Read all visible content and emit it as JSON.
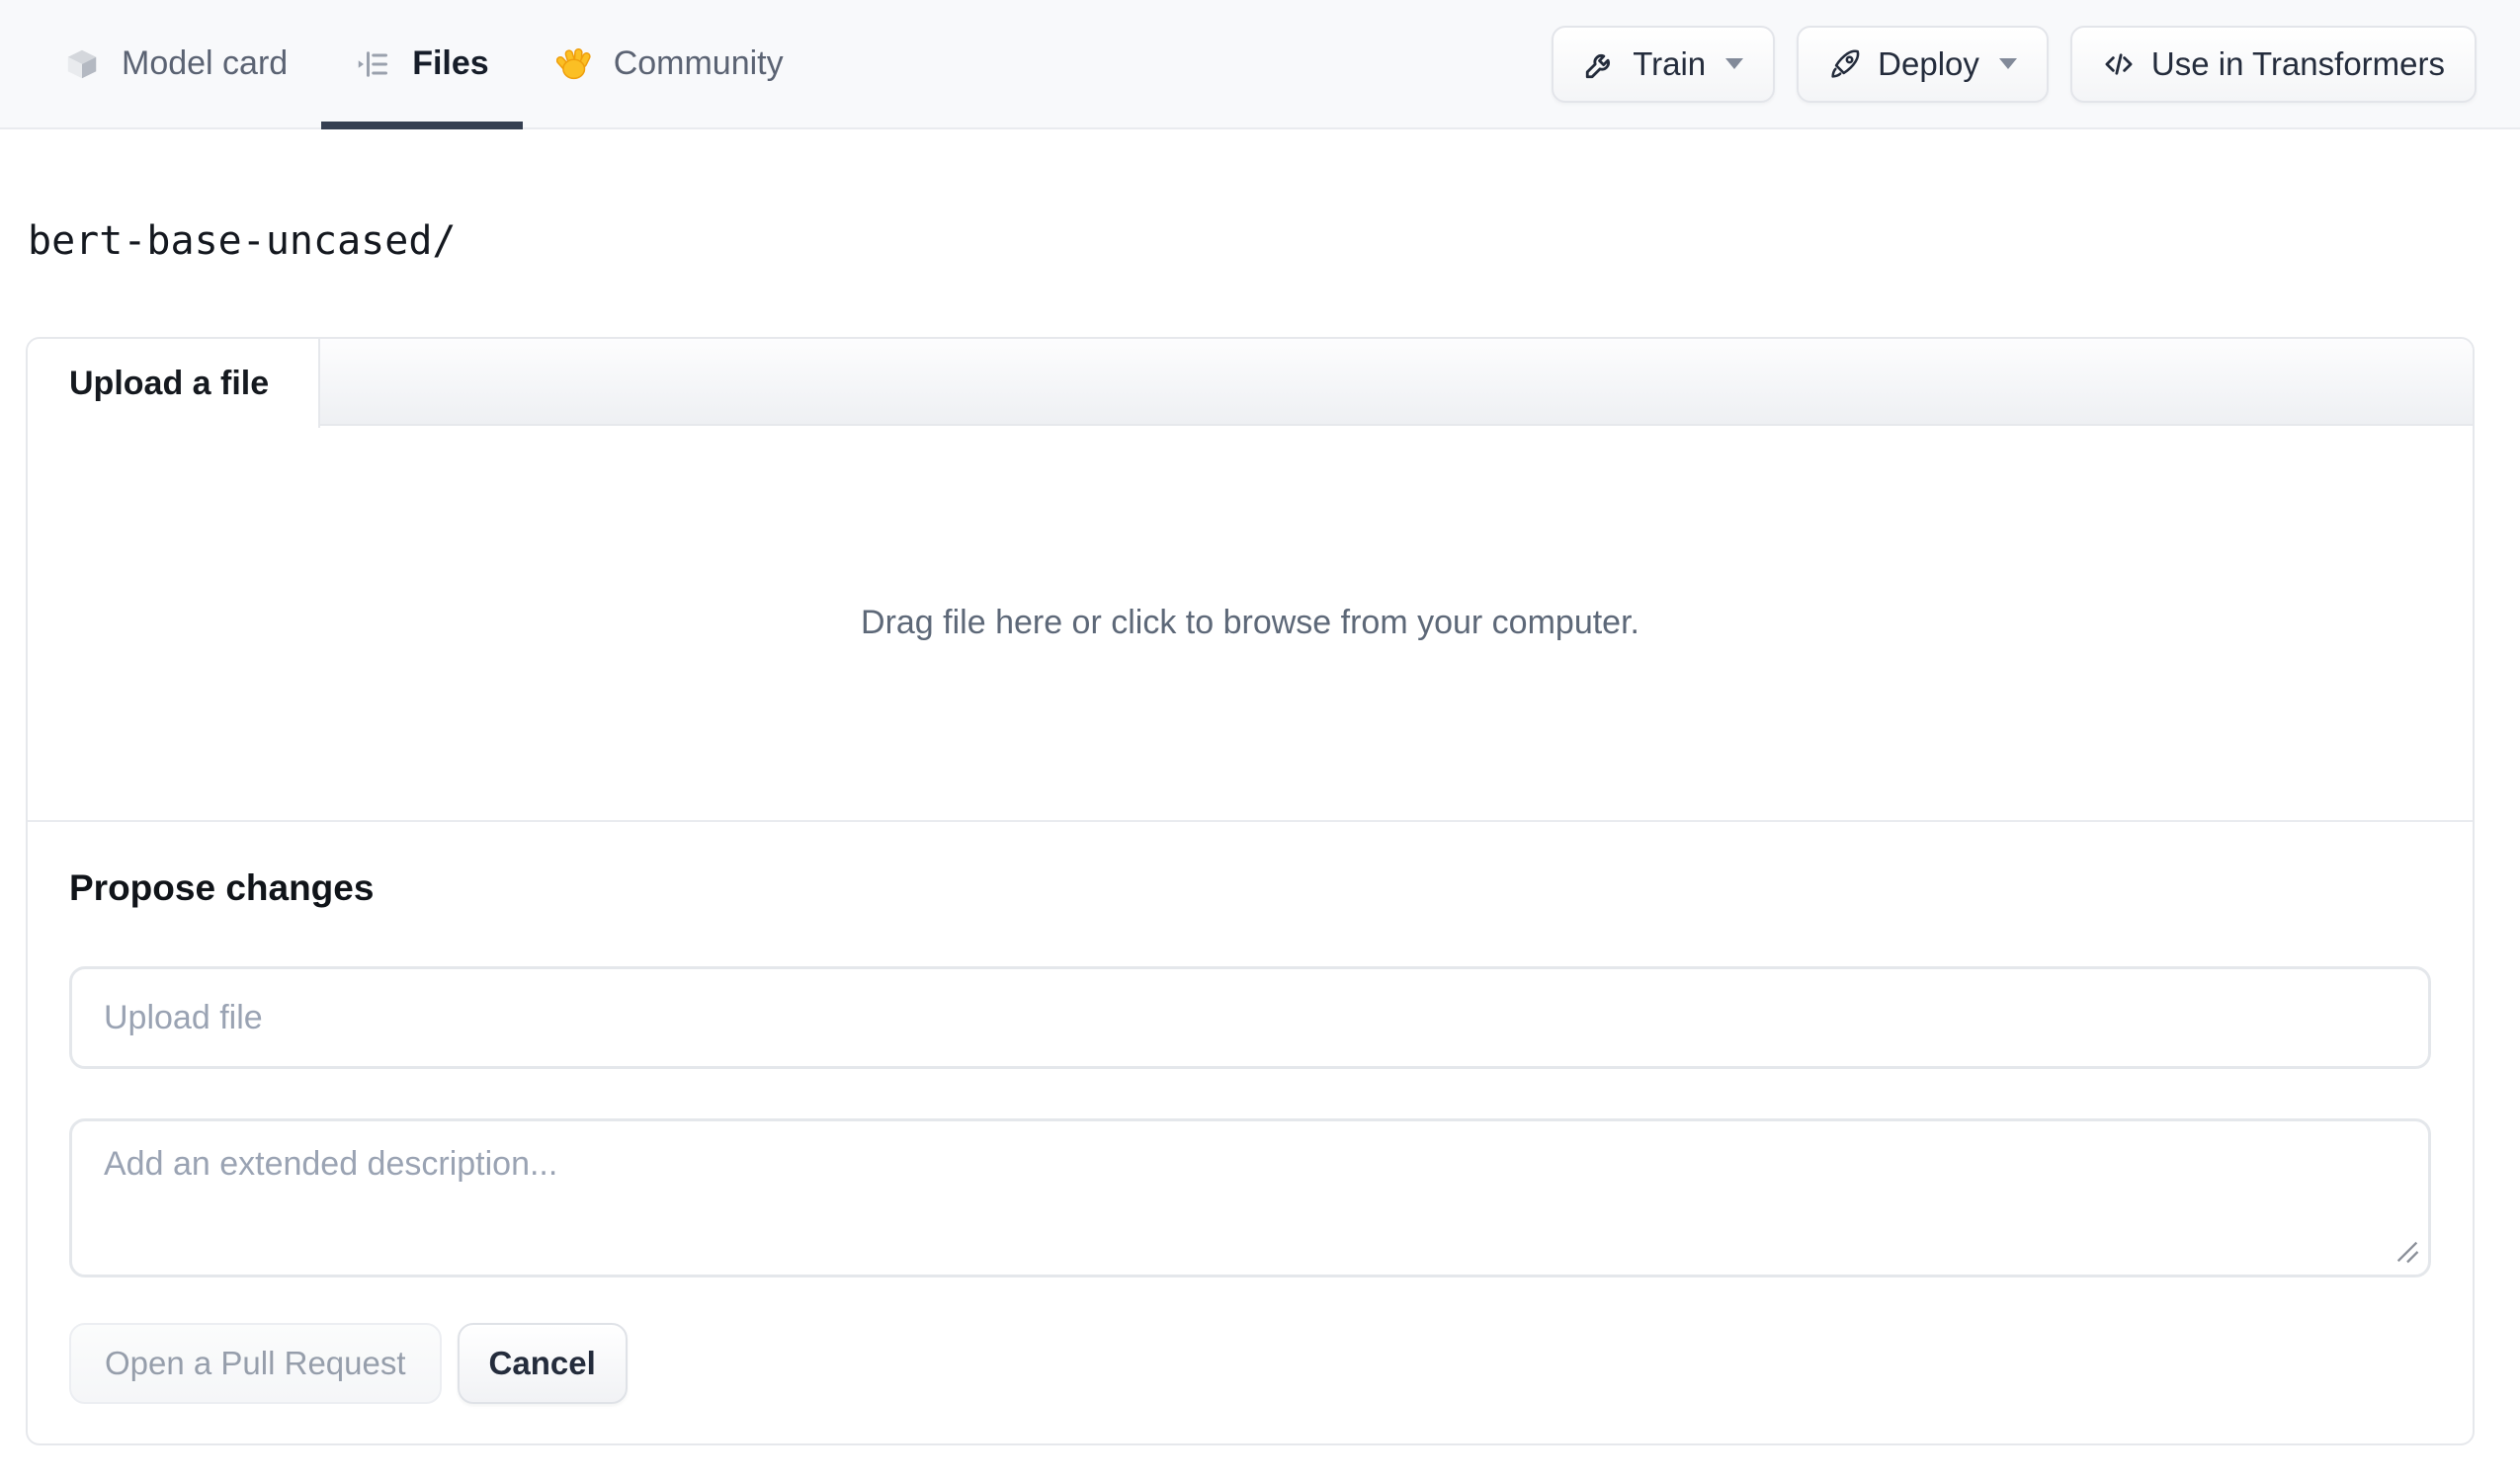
{
  "nav": {
    "tabs": [
      {
        "label": "Model card",
        "icon": "cube-icon",
        "active": false
      },
      {
        "label": "Files",
        "icon": "files-list-icon",
        "active": true
      },
      {
        "label": "Community",
        "icon": "waving-hand-icon",
        "active": false
      }
    ],
    "actions": [
      {
        "label": "Train",
        "icon": "wrench-icon",
        "has_dropdown": true
      },
      {
        "label": "Deploy",
        "icon": "rocket-icon",
        "has_dropdown": true
      },
      {
        "label": "Use in Transformers",
        "icon": "code-icon",
        "has_dropdown": false
      }
    ]
  },
  "breadcrumb": {
    "path": "bert-base-uncased/"
  },
  "upload_card": {
    "tab_label": "Upload a file",
    "dropzone_text": "Drag file here or click to browse from your computer.",
    "propose": {
      "heading": "Propose changes",
      "filename_placeholder": "Upload file",
      "filename_value": "",
      "description_placeholder": "Add an extended description...",
      "description_value": "",
      "primary_button_label": "Open a Pull Request",
      "cancel_button_label": "Cancel"
    }
  },
  "colors": {
    "nav_background": "#f8f9fb",
    "active_tab_underline": "#353f51",
    "border": "#e6e8ec",
    "muted_text": "#5b6373",
    "placeholder_text": "#9aa3b3",
    "dark_text": "#161d29",
    "disabled_button_text": "#969eab",
    "hand_emoji_yellow": "#fbbf24"
  }
}
